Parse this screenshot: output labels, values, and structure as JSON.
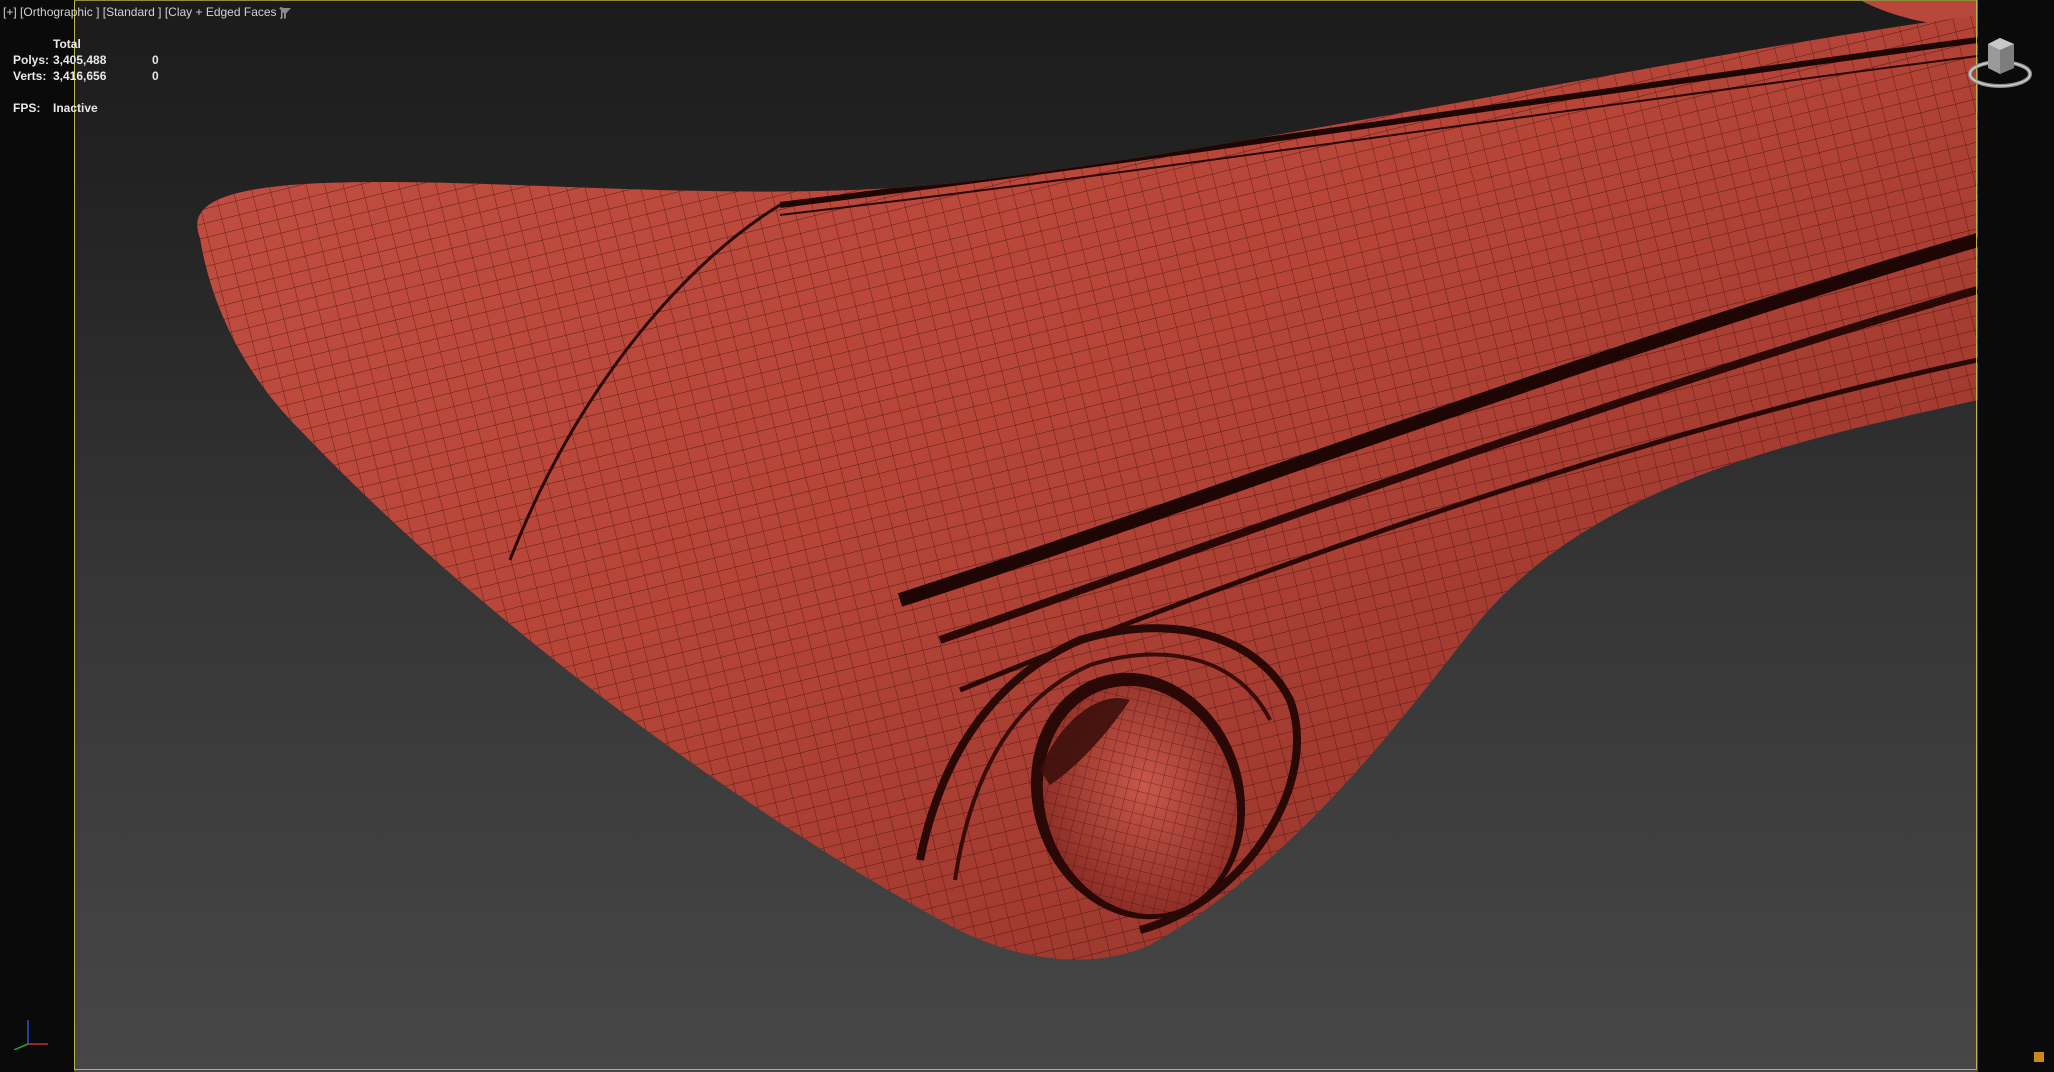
{
  "viewport": {
    "menu_label": "[+]",
    "view_label": "[Orthographic ]",
    "shading_label": "[Standard ]",
    "style_label": "[Clay + Edged Faces ]",
    "filter_icon": "filter-icon",
    "border_color": "#b8b64a"
  },
  "stats": {
    "header": "Total",
    "polys_label": "Polys:",
    "polys_total": "3,405,488",
    "polys_selected": "0",
    "verts_label": "Verts:",
    "verts_total": "3,416,656",
    "verts_selected": "0",
    "fps_label": "FPS:",
    "fps_value": "Inactive"
  },
  "icons": {
    "viewcube": "viewcube-icon",
    "axis": "axis-tripod-icon",
    "corner": "corner-icon"
  },
  "colors": {
    "model": "#b8473c",
    "wire": "#3a0d0a",
    "accent": "#c98a1a"
  }
}
